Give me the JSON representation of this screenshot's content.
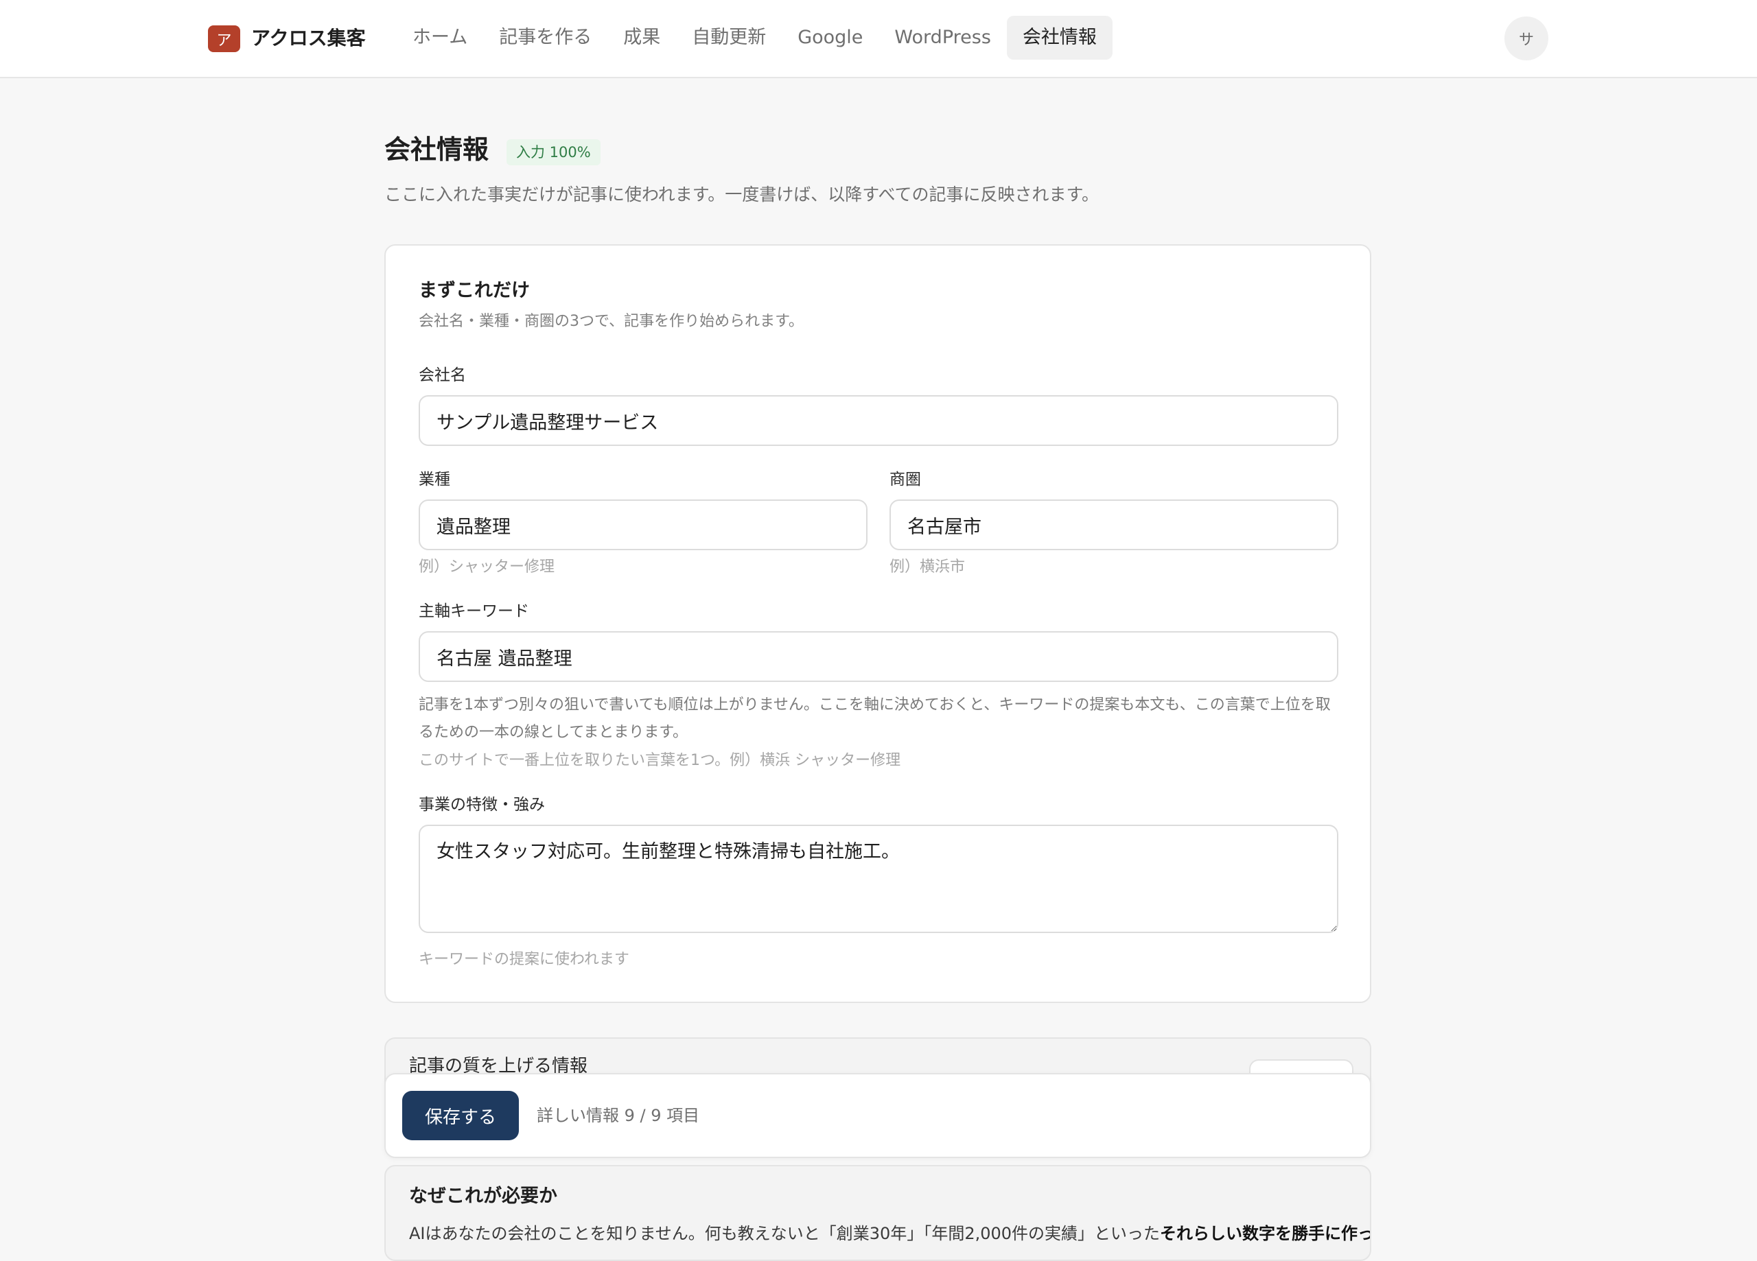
{
  "header": {
    "logo_char": "ア",
    "brand": "アクロス集客",
    "nav": [
      "ホーム",
      "記事を作る",
      "成果",
      "自動更新",
      "Google",
      "WordPress",
      "会社情報"
    ],
    "active_nav": "会社情報",
    "avatar_char": "サ"
  },
  "page": {
    "title": "会社情報",
    "progress_badge": "入力 100%",
    "progress_fraction": 1.0,
    "subtitle": "ここに入れた事実だけが記事に使われます。一度書けば、以降すべての記事に反映されます。"
  },
  "basics": {
    "title": "まずこれだけ",
    "subtitle": "会社名・業種・商圏の3つで、記事を作り始められます。",
    "company_name": {
      "label": "会社名",
      "value": "サンプル遺品整理サービス"
    },
    "industry": {
      "label": "業種",
      "value": "遺品整理",
      "hint": "例）シャッター修理"
    },
    "area": {
      "label": "商圏",
      "value": "名古屋市",
      "hint": "例）横浜市"
    },
    "main_keyword": {
      "label": "主軸キーワード",
      "value": "名古屋 遺品整理",
      "help_line1": "記事を1本ずつ別々の狙いで書いても順位は上がりません。ここを軸に決めておくと、キーワードの提案も本文も、この言葉で上位を取",
      "help_line2": "るための一本の線としてまとまります。",
      "hint": "このサイトで一番上位を取りたい言葉を1つ。例）横浜 シャッター修理"
    },
    "features": {
      "label": "事業の特徴・強み",
      "value": "女性スタッフ対応可。生前整理と特殊清掃も自社施工。",
      "hint": "キーワードの提案に使われます"
    }
  },
  "quality_section": {
    "title": "記事の質を上げる情報"
  },
  "savebar": {
    "save_label": "保存する",
    "status": "詳しい情報 9 / 9 項目"
  },
  "why": {
    "title": "なぜこれが必要か",
    "body_plain": "AIはあなたの会社のことを知りません。何も教えないと「創業30年」「年間2,000件の実績」といった",
    "body_bold": "それらしい数字を勝手に作ってしま"
  }
}
